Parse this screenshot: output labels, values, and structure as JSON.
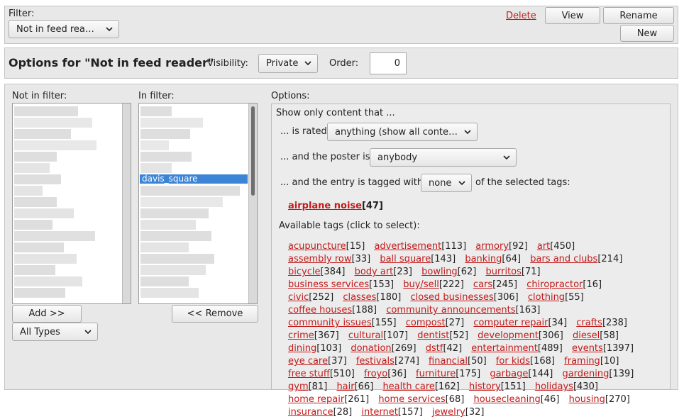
{
  "filter_bar": {
    "filter_label": "Filter:",
    "filter_select": "Not in feed reader",
    "delete_label": "Delete",
    "view_label": "View",
    "rename_label": "Rename",
    "new_label": "New"
  },
  "options_header": {
    "title": "Options for \"Not in feed reader\"",
    "visibility_label": "Visibility:",
    "visibility_value": "Private",
    "order_label": "Order:",
    "order_value": "0"
  },
  "lists": {
    "not_in_filter_label": "Not in filter:",
    "in_filter_label": "In filter:",
    "selected_item": "davis_square",
    "add_label": "Add >>",
    "remove_label": "<< Remove",
    "type_select": "All Types"
  },
  "options": {
    "label": "Options:",
    "show_only": "Show only content that ...",
    "rated_label": "... is rated",
    "rated_value": "anything (show all content)",
    "poster_label": "... and the poster is",
    "poster_value": "anybody",
    "tagged_label": "... and the entry is tagged with",
    "tagged_value": "none",
    "tagged_suffix": "of the selected tags:",
    "selected_tag_name": "airplane noise",
    "selected_tag_count": "[47]",
    "available_label": "Available tags (click to select):",
    "available_tags": [
      {
        "name": "acupuncture",
        "count": "[15]"
      },
      {
        "name": "advertisement",
        "count": "[113]"
      },
      {
        "name": "armory",
        "count": "[92]"
      },
      {
        "name": "art",
        "count": "[450]"
      },
      {
        "name": "assembly row",
        "count": "[33]"
      },
      {
        "name": "ball square",
        "count": "[143]"
      },
      {
        "name": "banking",
        "count": "[64]"
      },
      {
        "name": "bars and clubs",
        "count": "[214]"
      },
      {
        "name": "bicycle",
        "count": "[384]"
      },
      {
        "name": "body art",
        "count": "[23]"
      },
      {
        "name": "bowling",
        "count": "[62]"
      },
      {
        "name": "burritos",
        "count": "[71]"
      },
      {
        "name": "business services",
        "count": "[153]"
      },
      {
        "name": "buy/sell",
        "count": "[222]"
      },
      {
        "name": "cars",
        "count": "[245]"
      },
      {
        "name": "chiropractor",
        "count": "[16]"
      },
      {
        "name": "civic",
        "count": "[252]"
      },
      {
        "name": "classes",
        "count": "[180]"
      },
      {
        "name": "closed businesses",
        "count": "[306]"
      },
      {
        "name": "clothing",
        "count": "[55]"
      },
      {
        "name": "coffee houses",
        "count": "[188]"
      },
      {
        "name": "community announcements",
        "count": "[163]"
      },
      {
        "name": "community issues",
        "count": "[155]"
      },
      {
        "name": "compost",
        "count": "[27]"
      },
      {
        "name": "computer repair",
        "count": "[34]"
      },
      {
        "name": "crafts",
        "count": "[238]"
      },
      {
        "name": "crime",
        "count": "[367]"
      },
      {
        "name": "cultural",
        "count": "[107]"
      },
      {
        "name": "dentist",
        "count": "[52]"
      },
      {
        "name": "development",
        "count": "[306]"
      },
      {
        "name": "diesel",
        "count": "[58]"
      },
      {
        "name": "dining",
        "count": "[103]"
      },
      {
        "name": "donation",
        "count": "[269]"
      },
      {
        "name": "dstf",
        "count": "[42]"
      },
      {
        "name": "entertainment",
        "count": "[489]"
      },
      {
        "name": "events",
        "count": "[1397]"
      },
      {
        "name": "eye care",
        "count": "[37]"
      },
      {
        "name": "festivals",
        "count": "[274]"
      },
      {
        "name": "financial",
        "count": "[50]"
      },
      {
        "name": "for kids",
        "count": "[168]"
      },
      {
        "name": "framing",
        "count": "[10]"
      },
      {
        "name": "free stuff",
        "count": "[510]"
      },
      {
        "name": "froyo",
        "count": "[36]"
      },
      {
        "name": "furniture",
        "count": "[175]"
      },
      {
        "name": "garbage",
        "count": "[144]"
      },
      {
        "name": "gardening",
        "count": "[139]"
      },
      {
        "name": "gym",
        "count": "[81]"
      },
      {
        "name": "hair",
        "count": "[66]"
      },
      {
        "name": "health care",
        "count": "[162]"
      },
      {
        "name": "history",
        "count": "[151]"
      },
      {
        "name": "holidays",
        "count": "[430]"
      },
      {
        "name": "home repair",
        "count": "[261]"
      },
      {
        "name": "home services",
        "count": "[68]"
      },
      {
        "name": "housecleaning",
        "count": "[46]"
      },
      {
        "name": "housing",
        "count": "[270]"
      },
      {
        "name": "insurance",
        "count": "[28]"
      },
      {
        "name": "internet",
        "count": "[157]"
      },
      {
        "name": "jewelry",
        "count": "[32]"
      }
    ]
  },
  "colors": {
    "link": "#c21a1a",
    "selection": "#3b84d6",
    "panel": "#e8e8e8"
  }
}
